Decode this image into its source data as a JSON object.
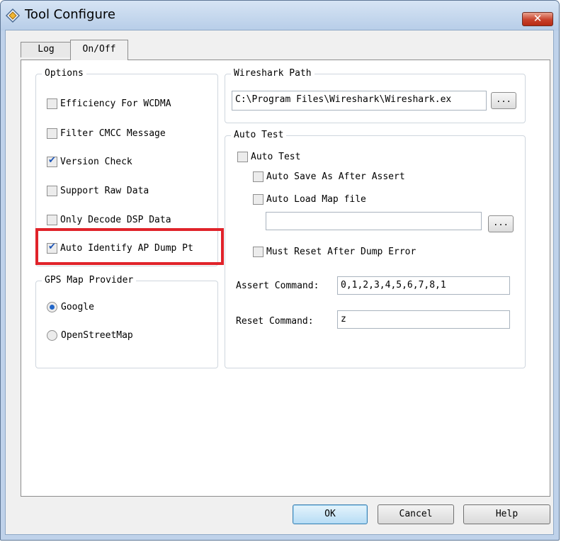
{
  "window": {
    "title": "Tool Configure",
    "close_label": "✕"
  },
  "tabs": [
    {
      "label": "Log",
      "selected": false
    },
    {
      "label": "On/Off",
      "selected": true
    }
  ],
  "options": {
    "title": "Options",
    "items": [
      {
        "label": "Efficiency For WCDMA",
        "checked": false
      },
      {
        "label": "Filter CMCC Message",
        "checked": false
      },
      {
        "label": "Version Check",
        "checked": true
      },
      {
        "label": "Support Raw Data",
        "checked": false
      },
      {
        "label": "Only Decode DSP Data",
        "checked": false
      },
      {
        "label": "Auto Identify AP Dump Pt",
        "checked": true
      }
    ]
  },
  "gps": {
    "title": "GPS Map Provider",
    "options": [
      {
        "label": "Google",
        "selected": true
      },
      {
        "label": "OpenStreetMap",
        "selected": false
      }
    ]
  },
  "wireshark": {
    "title": "Wireshark Path",
    "path": "C:\\Program Files\\Wireshark\\Wireshark.ex",
    "browse_label": "..."
  },
  "auto_test": {
    "title": "Auto Test",
    "auto_test_label": "Auto Test",
    "auto_test_checked": false,
    "auto_save_label": "Auto Save As After Assert",
    "auto_save_checked": false,
    "auto_load_label": "Auto Load Map file",
    "auto_load_checked": false,
    "map_file_path": "",
    "map_browse_label": "...",
    "must_reset_label": "Must Reset After Dump Error",
    "must_reset_checked": false,
    "assert_command_label": "Assert Command:",
    "assert_command_value": "0,1,2,3,4,5,6,7,8,1",
    "reset_command_label": "Reset Command:",
    "reset_command_value": "z"
  },
  "footer": {
    "ok_label": "OK",
    "cancel_label": "Cancel",
    "help_label": "Help"
  },
  "colors": {
    "highlight": "#e0232a",
    "check_accent": "#1d56b8",
    "title_bar": "#c9dbf0"
  }
}
